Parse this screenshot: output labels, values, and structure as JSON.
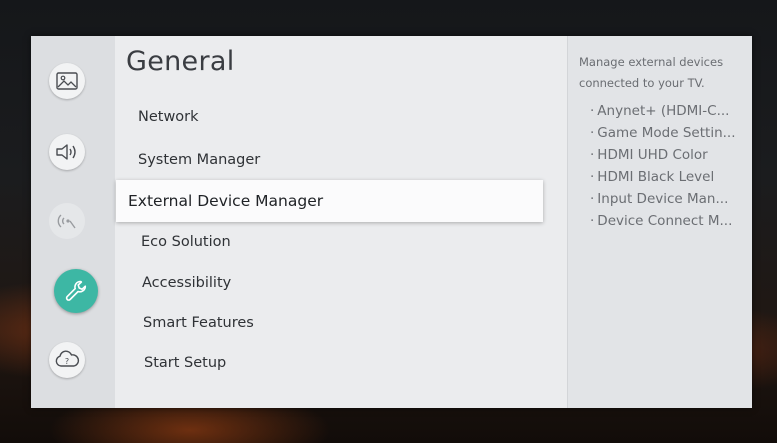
{
  "rail": {
    "items": [
      {
        "name": "Picture",
        "icon": "picture-icon",
        "state": "normal"
      },
      {
        "name": "Sound",
        "icon": "sound-icon",
        "state": "normal"
      },
      {
        "name": "Broadcasting",
        "icon": "broadcasting-icon",
        "state": "disabled"
      },
      {
        "name": "General",
        "icon": "wrench-icon",
        "state": "selected"
      },
      {
        "name": "Support",
        "icon": "support-cloud-icon",
        "state": "normal"
      }
    ],
    "accent_color": "#3db7a4"
  },
  "main": {
    "title": "General",
    "items": [
      {
        "label": "Network"
      },
      {
        "label": "System Manager"
      },
      {
        "label": "External Device Manager",
        "selected": true
      },
      {
        "label": "Eco Solution"
      },
      {
        "label": "Accessibility"
      },
      {
        "label": "Smart Features"
      },
      {
        "label": "Start Setup"
      }
    ]
  },
  "side": {
    "description": "Manage external devices connected to your TV.",
    "bullet": "·",
    "items": [
      "Anynet+ (HDMI-C...",
      "Game Mode Settin...",
      "HDMI UHD Color",
      "HDMI Black Level",
      "Input Device Man...",
      "Device Connect M..."
    ]
  }
}
